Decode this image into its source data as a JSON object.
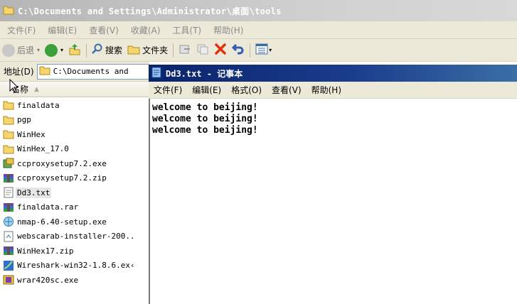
{
  "explorer": {
    "title": "C:\\Documents and Settings\\Administrator\\桌面\\tools",
    "menu": [
      "文件(F)",
      "编辑(E)",
      "查看(V)",
      "收藏(A)",
      "工具(T)",
      "帮助(H)"
    ],
    "toolbar": {
      "back_label": "后退",
      "search_label": "搜索",
      "folders_label": "文件夹"
    },
    "address": {
      "label": "地址(D)",
      "value": "C:\\Documents and"
    },
    "column_name": "名称",
    "files": [
      {
        "name": "finaldata",
        "icon": "folder-icon"
      },
      {
        "name": "pgp",
        "icon": "folder-icon"
      },
      {
        "name": "WinHex",
        "icon": "folder-icon"
      },
      {
        "name": "WinHex_17.0",
        "icon": "folder-icon"
      },
      {
        "name": "ccproxysetup7.2.exe",
        "icon": "installer-icon"
      },
      {
        "name": "ccproxysetup7.2.zip",
        "icon": "archive-icon"
      },
      {
        "name": "Dd3.txt",
        "icon": "text-file-icon"
      },
      {
        "name": "finaldata.rar",
        "icon": "archive-icon"
      },
      {
        "name": "nmap-6.40-setup.exe",
        "icon": "nmap-icon"
      },
      {
        "name": "webscarab-installer-200..",
        "icon": "jar-file-icon"
      },
      {
        "name": "WinHex17.zip",
        "icon": "archive-icon"
      },
      {
        "name": "Wireshark-win32-1.8.6.ex‹",
        "icon": "wireshark-icon"
      },
      {
        "name": "wrar420sc.exe",
        "icon": "winrar-installer-icon"
      }
    ]
  },
  "notepad": {
    "title": "Dd3.txt - 记事本",
    "menu": [
      "文件(F)",
      "编辑(E)",
      "格式(O)",
      "查看(V)",
      "帮助(H)"
    ],
    "lines": [
      "welcome to beijing!",
      "welcome to beijing!",
      "welcome to beijing!"
    ]
  }
}
